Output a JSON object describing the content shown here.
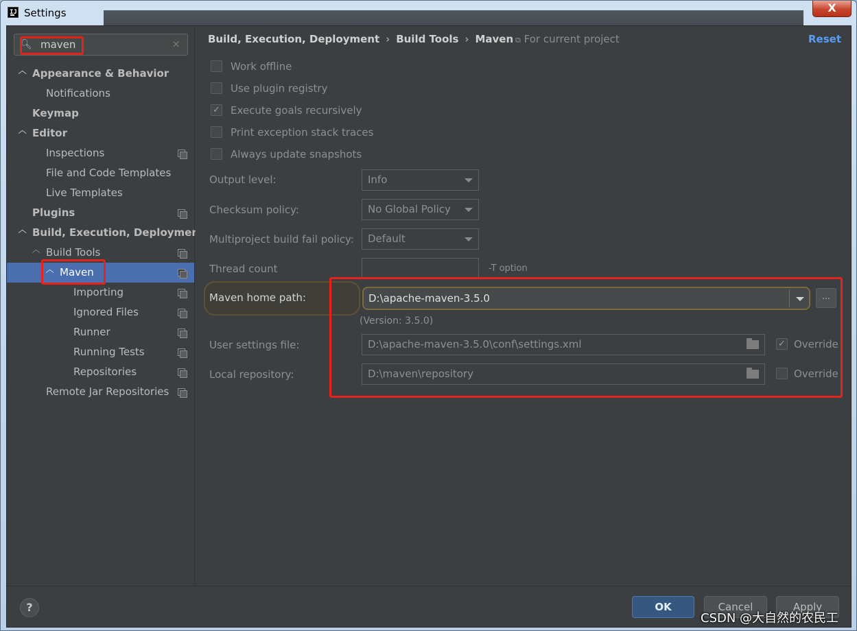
{
  "window": {
    "title": "Settings",
    "close_symbol": "X"
  },
  "search": {
    "value": "maven",
    "clear_symbol": "×"
  },
  "tree": [
    {
      "label": "Appearance & Behavior",
      "arrow": "v"
    },
    {
      "label": "Notifications"
    },
    {
      "label": "Keymap"
    },
    {
      "label": "Editor",
      "arrow": "v"
    },
    {
      "label": "Inspections"
    },
    {
      "label": "File and Code Templates"
    },
    {
      "label": "Live Templates"
    },
    {
      "label": "Plugins"
    },
    {
      "label": "Build, Execution, Deployment",
      "arrow": "v"
    },
    {
      "label": "Build Tools",
      "arrow": "v"
    },
    {
      "label": "Maven",
      "arrow": "v",
      "selected": true
    },
    {
      "label": "Importing"
    },
    {
      "label": "Ignored Files"
    },
    {
      "label": "Runner"
    },
    {
      "label": "Running Tests"
    },
    {
      "label": "Repositories"
    },
    {
      "label": "Remote Jar Repositories"
    }
  ],
  "breadcrumb": [
    "Build, Execution, Deployment",
    "Build Tools",
    "Maven"
  ],
  "breadcrumb_sep": "›",
  "for_current_project": "For current project",
  "reset_label": "Reset",
  "checkboxes": [
    {
      "label": "Work offline",
      "checked": false
    },
    {
      "label": "Use plugin registry",
      "checked": false
    },
    {
      "label": "Execute goals recursively",
      "checked": true
    },
    {
      "label": "Print exception stack traces",
      "checked": false
    },
    {
      "label": "Always update snapshots",
      "checked": false
    }
  ],
  "output_level": {
    "label": "Output level:",
    "value": "Info"
  },
  "checksum_policy": {
    "label": "Checksum policy:",
    "value": "No Global Policy"
  },
  "multiproject_policy": {
    "label": "Multiproject build fail policy:",
    "value": "Default"
  },
  "thread_count": {
    "label": "Thread count",
    "value": "",
    "hint": "-T option"
  },
  "maven_home": {
    "label": "Maven home path:",
    "value": "D:\\apache-maven-3.5.0",
    "version": "(Version: 3.5.0)",
    "browse": "..."
  },
  "user_settings": {
    "label": "User settings file:",
    "value": "D:\\apache-maven-3.5.0\\conf\\settings.xml",
    "override_label": "Override",
    "override_checked": true
  },
  "local_repo": {
    "label": "Local repository:",
    "value": "D:\\maven\\repository",
    "override_label": "Override",
    "override_checked": false
  },
  "buttons": {
    "help": "?",
    "ok": "OK",
    "cancel": "Cancel",
    "apply": "Apply"
  },
  "watermark": "CSDN @大自然的农民工",
  "colors": {
    "accent": "#4b6eaf",
    "highlight": "#e5231b",
    "link": "#589df6"
  }
}
